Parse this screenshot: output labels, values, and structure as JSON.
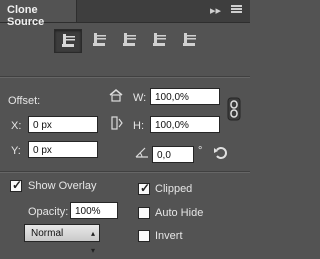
{
  "panel": {
    "title": "Clone Source",
    "menu_icon": "double-chevron-right-icon",
    "panel_menu_icon": "menu-icon",
    "source_buttons": [
      {
        "name": "clone-source-1-button",
        "active": true
      },
      {
        "name": "clone-source-2-button",
        "active": false
      },
      {
        "name": "clone-source-3-button",
        "active": false
      },
      {
        "name": "clone-source-4-button",
        "active": false
      },
      {
        "name": "clone-source-5-button",
        "active": false
      }
    ]
  },
  "offset": {
    "label": "Offset:",
    "x_label": "X:",
    "x_value": "0 px",
    "y_label": "Y:",
    "y_value": "0 px",
    "w_label": "W:",
    "w_value": "100,0%",
    "h_label": "H:",
    "h_value": "100,0%",
    "angle_value": "0,0",
    "degree_symbol": "°"
  },
  "overlay": {
    "show_overlay_label": "Show Overlay",
    "show_overlay_checked": true,
    "opacity_label": "Opacity:",
    "opacity_value": "100%",
    "blend_mode": "Normal",
    "clipped_label": "Clipped",
    "clipped_checked": true,
    "auto_hide_label": "Auto Hide",
    "auto_hide_checked": false,
    "invert_label": "Invert",
    "invert_checked": false
  }
}
